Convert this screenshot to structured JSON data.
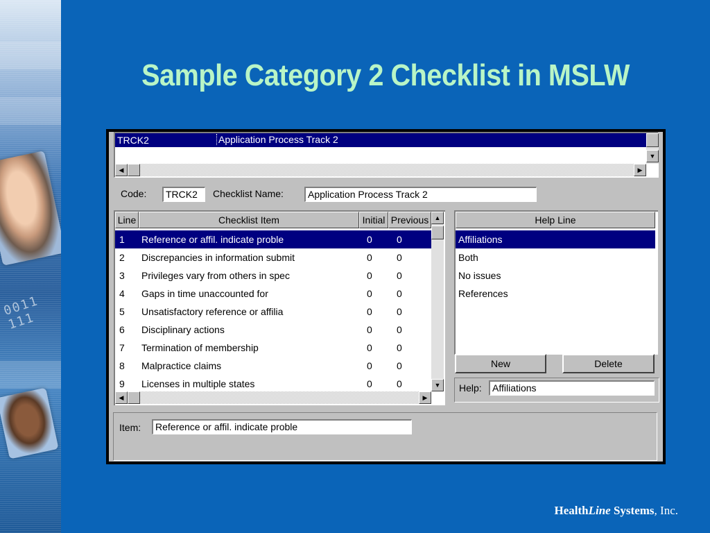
{
  "slide": {
    "title": "Sample Category 2 Checklist in MSLW",
    "footer": {
      "brand_a": "Health",
      "brand_b": "Line",
      "brand_c": " Systems",
      "suffix": ", Inc."
    }
  },
  "top_list": {
    "selected_code": "TRCK2",
    "selected_name": "Application Process Track 2"
  },
  "form": {
    "code_label": "Code:",
    "code_value": "TRCK2",
    "checklist_name_label": "Checklist Name:",
    "checklist_name_value": "Application Process Track 2",
    "help_label": "Help:",
    "help_value": "Affiliations",
    "item_label": "Item:",
    "item_value": "Reference or affil. indicate proble"
  },
  "checklist": {
    "columns": [
      "Line",
      "Checklist Item",
      "Initial",
      "Previous"
    ],
    "rows": [
      {
        "line": "1",
        "item": "Reference or affil. indicate proble",
        "initial": "0",
        "previous": "0"
      },
      {
        "line": "2",
        "item": "Discrepancies in information submit",
        "initial": "0",
        "previous": "0"
      },
      {
        "line": "3",
        "item": "Privileges vary from others in spec",
        "initial": "0",
        "previous": "0"
      },
      {
        "line": "4",
        "item": "Gaps in time unaccounted for",
        "initial": "0",
        "previous": "0"
      },
      {
        "line": "5",
        "item": "Unsatisfactory reference or affilia",
        "initial": "0",
        "previous": "0"
      },
      {
        "line": "6",
        "item": "Disciplinary actions",
        "initial": "0",
        "previous": "0"
      },
      {
        "line": "7",
        "item": "Termination of membership",
        "initial": "0",
        "previous": "0"
      },
      {
        "line": "8",
        "item": "Malpractice claims",
        "initial": "0",
        "previous": "0"
      },
      {
        "line": "9",
        "item": "Licenses in multiple states",
        "initial": "0",
        "previous": "0"
      }
    ]
  },
  "help_line": {
    "header": "Help Line",
    "items": [
      "Affiliations",
      "Both",
      "No issues",
      "References"
    ],
    "new_button": "New",
    "delete_button": "Delete"
  },
  "decor": {
    "binary_text": "0011\n11",
    "selection_color": "#000080",
    "title_color": "#b9f5c6",
    "background_color": "#0a64b8"
  }
}
